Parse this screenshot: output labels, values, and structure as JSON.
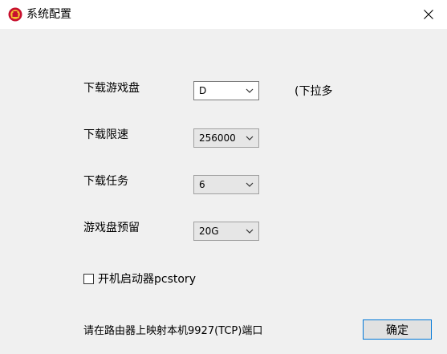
{
  "window": {
    "title": "系统配置",
    "close_icon": "close-icon",
    "app_icon": "red-emblem-icon"
  },
  "settings": [
    {
      "label": "下载游戏盘",
      "value": "D"
    },
    {
      "label": "下载限速",
      "value": "256000"
    },
    {
      "label": "下载任务",
      "value": "6"
    },
    {
      "label": "游戏盘预留",
      "value": "20G"
    }
  ],
  "hint": "(下拉多",
  "autostart": {
    "label": "开机启动器pcstory",
    "checked": false
  },
  "footer": {
    "note": "请在路由器上映射本机9927(TCP)端口"
  },
  "buttons": {
    "ok": "确定"
  },
  "colors": {
    "accent_border": "#0078d7",
    "titlebar": "#ffffff",
    "body": "#f0f0f0"
  }
}
